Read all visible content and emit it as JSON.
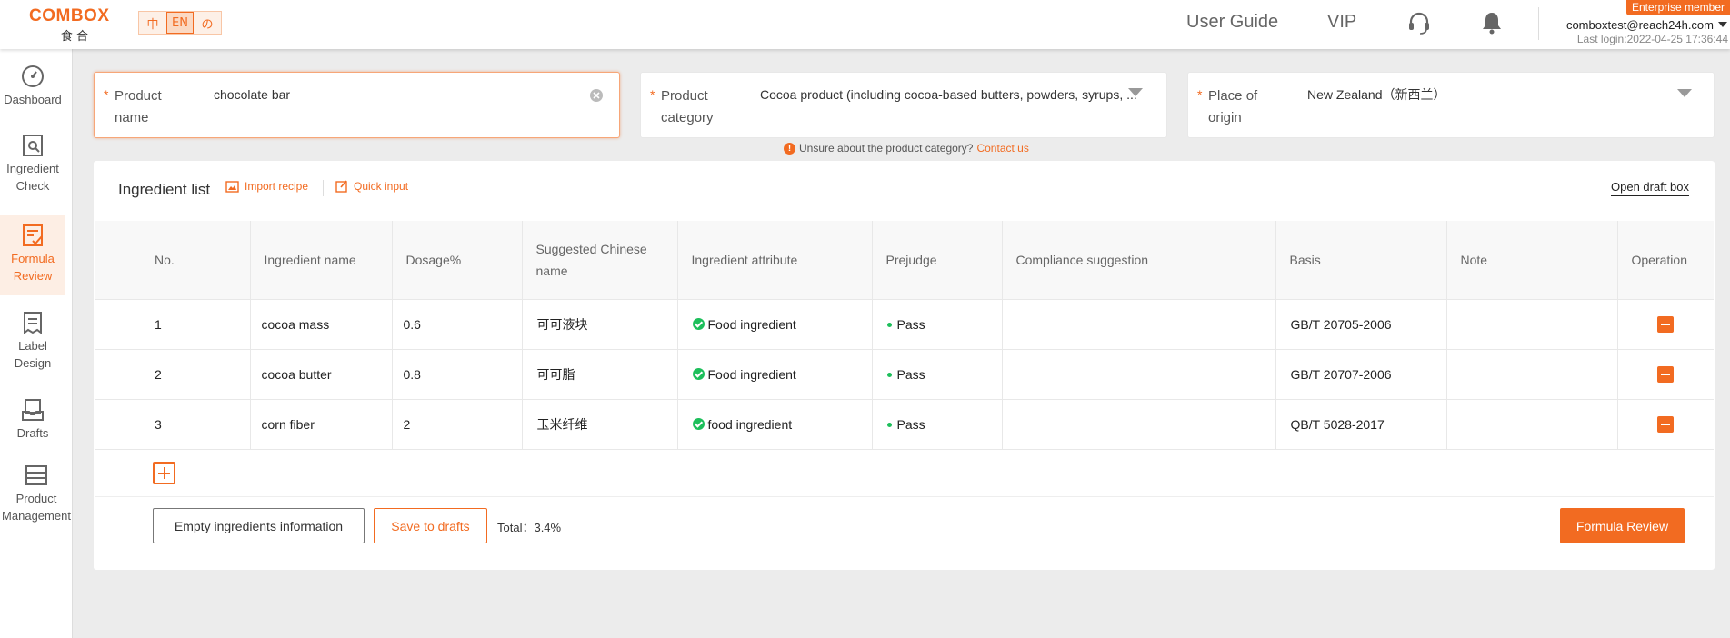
{
  "header": {
    "logo_main": "COMBOX",
    "logo_sub": "食 合",
    "languages": [
      "中",
      "EN",
      "の"
    ],
    "nav_user_guide": "User Guide",
    "nav_vip": "VIP",
    "icons": [
      "headset-icon",
      "bell-icon"
    ],
    "member_badge": "Enterprise member",
    "email": "comboxtest@reach24h.com",
    "last_login": "Last login:2022-04-25 17:36:44"
  },
  "sidebar": {
    "items": [
      {
        "label": "Dashboard",
        "icon": "dashboard-icon",
        "active": false
      },
      {
        "label": "Ingredient Check",
        "icon": "ingredient-check-icon",
        "active": false
      },
      {
        "label": "Formula Review",
        "icon": "formula-review-icon",
        "active": true
      },
      {
        "label": "Label Design",
        "icon": "label-design-icon",
        "active": false
      },
      {
        "label": "Drafts",
        "icon": "drafts-icon",
        "active": false
      },
      {
        "label": "Product Management",
        "icon": "product-management-icon",
        "active": false
      }
    ]
  },
  "form": {
    "required_mark": "*",
    "product_name_label": "Product name",
    "product_name_value": "chocolate bar",
    "product_category_label": "Product category",
    "product_category_value": "Cocoa product (including cocoa-based butters, powders, syrups, ...",
    "origin_label": "Place of origin",
    "origin_value": "New Zealand（新西兰）",
    "hint_text": "Unsure about the product category?",
    "hint_link": "Contact us"
  },
  "ingredients": {
    "title": "Ingredient list",
    "import_recipe": "Import recipe",
    "quick_input": "Quick input",
    "open_draft_box": "Open draft box",
    "columns": [
      "No.",
      "Ingredient name",
      "Dosage%",
      "Suggested Chinese name",
      "Ingredient attribute",
      "Prejudge",
      "Compliance suggestion",
      "Basis",
      "Note",
      "Operation"
    ],
    "rows": [
      {
        "no": "1",
        "name": "cocoa mass",
        "dosage": "0.6",
        "chinese_name": "可可液块",
        "attribute": "Food ingredient",
        "prejudge": "Pass",
        "suggestion": "",
        "basis": "GB/T 20705-2006",
        "note": ""
      },
      {
        "no": "2",
        "name": "cocoa butter",
        "dosage": "0.8",
        "chinese_name": "可可脂",
        "attribute": "Food ingredient",
        "prejudge": "Pass",
        "suggestion": "",
        "basis": "GB/T 20707-2006",
        "note": ""
      },
      {
        "no": "3",
        "name": "corn fiber",
        "dosage": "2",
        "chinese_name": "玉米纤维",
        "attribute": "food ingredient",
        "prejudge": "Pass",
        "suggestion": "",
        "basis": "QB/T 5028-2017",
        "note": ""
      }
    ]
  },
  "footer": {
    "empty_button": "Empty ingredients information",
    "save_button": "Save to drafts",
    "total_label": "Total：",
    "total_value": "3.4%",
    "review_button": "Formula Review"
  },
  "colors": {
    "accent": "#f26b21",
    "pass": "#1dbf5b"
  }
}
